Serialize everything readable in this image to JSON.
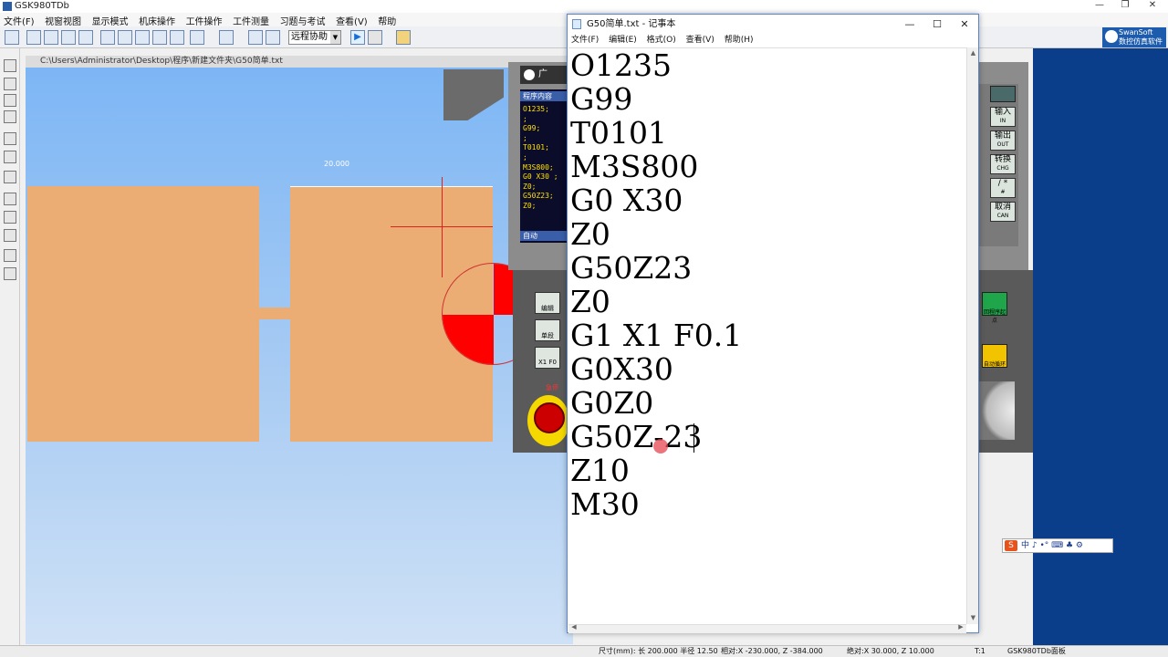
{
  "app": {
    "title": "GSK980TDb",
    "minimize": "—",
    "restore": "❐",
    "close": "✕",
    "menu": [
      "文件(F)",
      "视窗视图",
      "显示模式",
      "机床操作",
      "工件操作",
      "工件测量",
      "习题与考试",
      "查看(V)",
      "帮助"
    ],
    "combo_value": "远程协助",
    "brand_line1": "SwanSoft",
    "brand_line2": "数控仿真软件"
  },
  "viewport": {
    "path": "C:\\Users\\Administrator\\Desktop\\程序\\新建文件夹\\G50简单.txt",
    "dimension": "20.000"
  },
  "cnc": {
    "logo": "广",
    "screen_header": "程序内容",
    "program": "O1235;\n;\nG99;\n;\nT0101;\n;\nM3S800;\nG0 X30 ;\nZ0;\nG50Z23;\nZ0;",
    "mode": "自动",
    "buttons": [
      {
        "label": "编辑"
      },
      {
        "label": "单段"
      },
      {
        "label": "X1 F0"
      }
    ],
    "estop_label": "急停",
    "keys": [
      {
        "main": "输入",
        "sub": "IN"
      },
      {
        "main": "输出",
        "sub": "OUT"
      },
      {
        "main": "转换",
        "sub": "CHG"
      },
      {
        "main": "/ *",
        "sub": "#"
      },
      {
        "main": "取消",
        "sub": "CAN"
      }
    ],
    "side_buttons": [
      {
        "label": "回程序起点",
        "color": "#1fa54a"
      },
      {
        "label": "自动循环",
        "color": "#f2c400"
      }
    ]
  },
  "ime": {
    "logo": "S",
    "text": "中 ♪ •° ⌨ ♣ ⚙"
  },
  "statusbar": {
    "size": "尺寸(mm): 长 200.000 半径  12.50",
    "relative": "相对:X -230.000, Z -384.000",
    "absolute": "绝对:X  30.000, Z  10.000",
    "t": "T:1",
    "panel": "GSK980TDb面板"
  },
  "notepad": {
    "title": "G50简单.txt - 记事本",
    "minimize": "—",
    "maximize": "☐",
    "close": "✕",
    "menu": [
      "文件(F)",
      "编辑(E)",
      "格式(O)",
      "查看(V)",
      "帮助(H)"
    ],
    "lines": [
      "O1235",
      "G99",
      "T0101",
      "M3S800",
      "G0 X30",
      "Z0",
      "G50Z23",
      "Z0",
      "G1 X1 F0.1",
      "G0X30",
      "G0Z0",
      "G50Z-23",
      "Z10",
      "M30"
    ],
    "scroll_up": "▲",
    "scroll_down": "▼",
    "scroll_left": "◀",
    "scroll_right": "▶"
  }
}
